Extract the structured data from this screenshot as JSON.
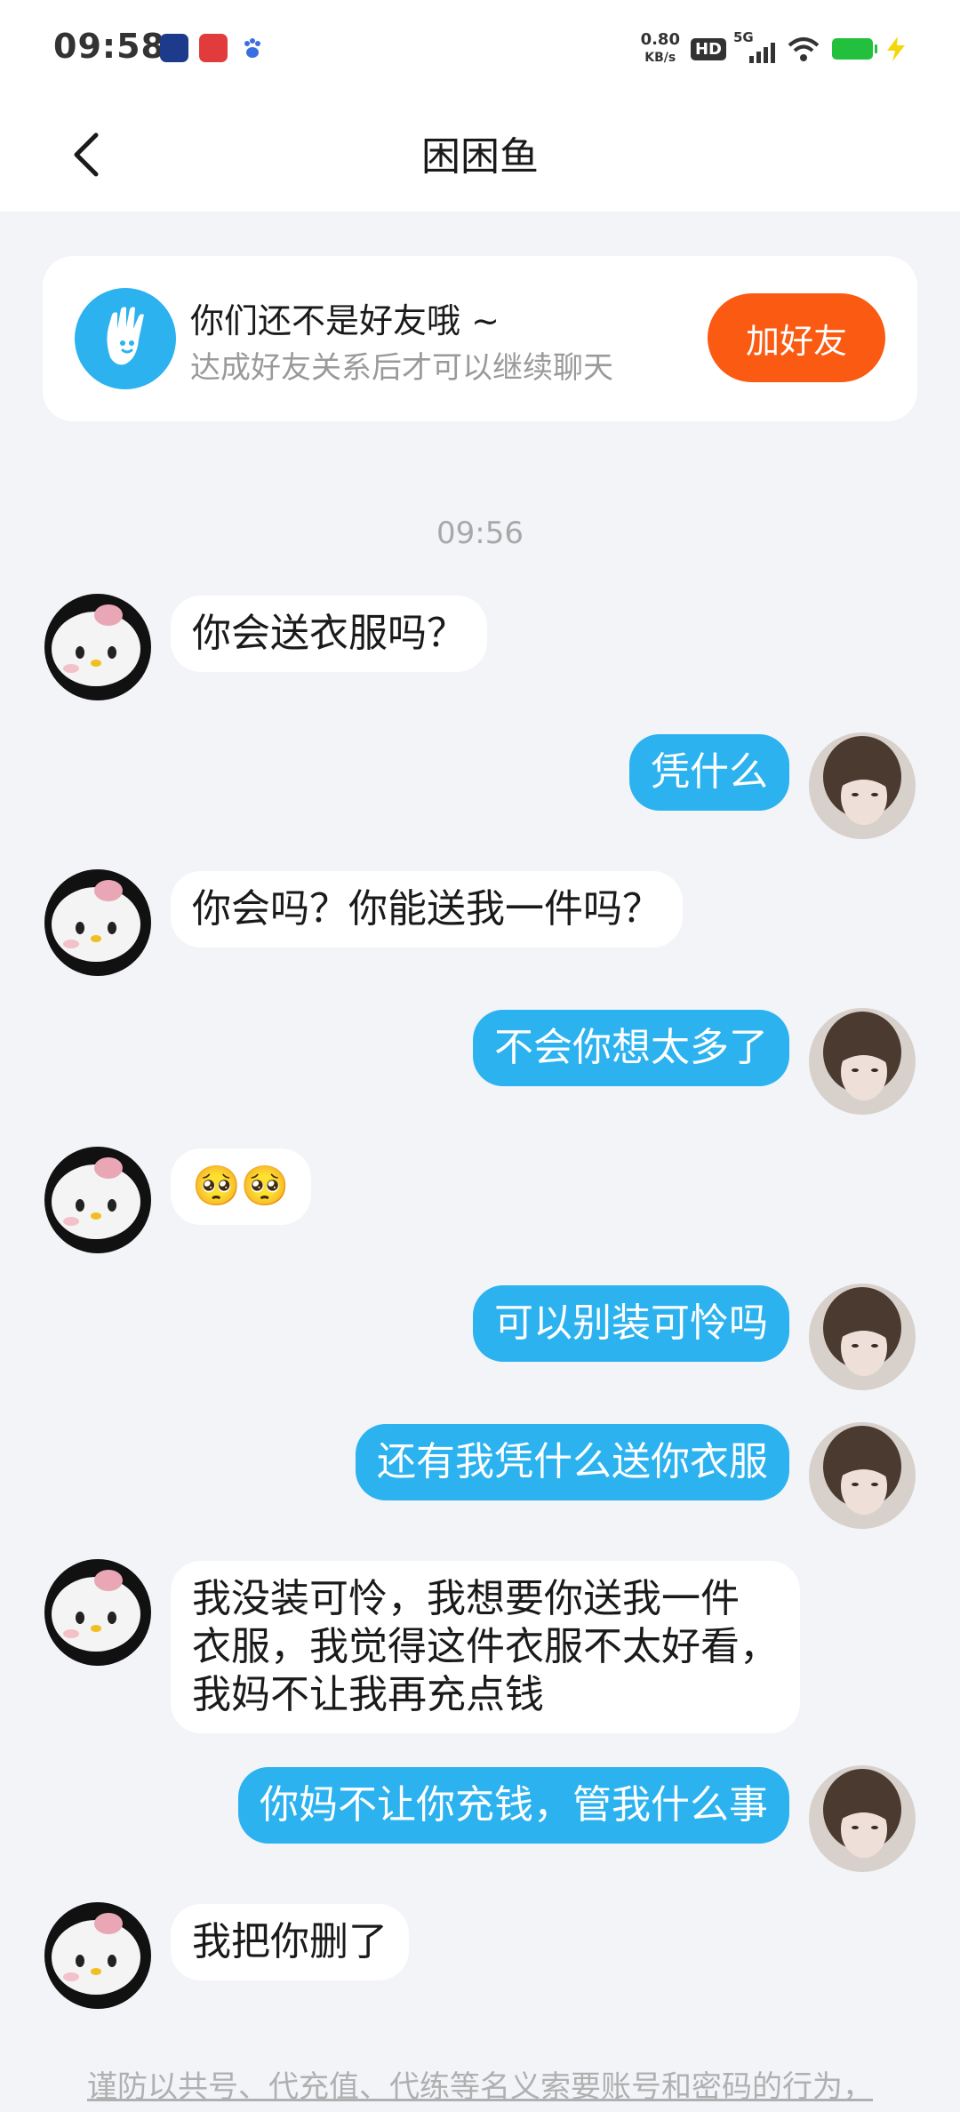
{
  "status_bar": {
    "time": "09:58",
    "net_speed_value": "0.80",
    "net_speed_unit": "KB/s",
    "hd_label": "HD",
    "network_label": "5G",
    "icons": [
      "app-badge-icon",
      "video-app-icon",
      "paw-icon",
      "wifi-icon",
      "battery-icon",
      "charging-icon"
    ]
  },
  "header": {
    "title": "困困鱼"
  },
  "banner": {
    "title": "你们还不是好友哦 ~",
    "subtitle": "达成好友关系后才可以继续聊天",
    "button_label": "加好友",
    "accent_color": "#fa5a12",
    "icon_color": "#2bb2ef"
  },
  "time_divider": "09:56",
  "messages": [
    {
      "side": "in",
      "text": "你会送衣服吗？"
    },
    {
      "side": "out",
      "text": "凭什么"
    },
    {
      "side": "in",
      "text": "你会吗？你能送我一件吗？"
    },
    {
      "side": "out",
      "text": "不会你想太多了"
    },
    {
      "side": "in",
      "text": "🥺🥺"
    },
    {
      "side": "out",
      "text": "可以别装可怜吗"
    },
    {
      "side": "out",
      "text": "还有我凭什么送你衣服"
    },
    {
      "side": "in",
      "text": "我没装可怜，我想要你送我一件\n衣服，我觉得这件衣服不太好看，\n我妈不让我再充点钱"
    },
    {
      "side": "out",
      "text": "你妈不让你充钱，管我什么事"
    },
    {
      "side": "in",
      "text": "我把你删了"
    }
  ],
  "notice": "谨防以共号、代充值、代练等名义索要账号和密码的行为，",
  "colors": {
    "outgoing_bubble": "#2bb2ef",
    "incoming_bubble": "#ffffff",
    "background": "#f2f4f8"
  }
}
